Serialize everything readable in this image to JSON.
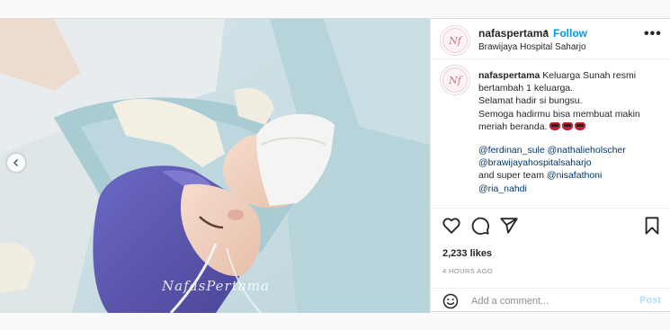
{
  "header": {
    "avatar_monogram": "Nf",
    "username": "nafaspertama",
    "separator": "•",
    "follow_label": "Follow",
    "location": "Brawijaya Hospital Saharjo",
    "more_icon": "more-horizontal-icon"
  },
  "media": {
    "watermark": "NafasPertama",
    "prev_icon": "chevron-left-icon"
  },
  "caption": {
    "username": "nafaspertama",
    "lines": [
      "Keluarga Sunah resmi",
      "bertambah 1 keluarga.",
      "Selamat hadir si bungsu.",
      "Semoga hadirmu bisa membuat makin",
      "meriah beranda."
    ],
    "emoji_count": 3,
    "mentions_line1": "@ferdinan_sule @nathalieholscher",
    "mentions_line2": "@brawijayahospitalsaharjo",
    "team_prefix": "and super team ",
    "team_mention": "@nisafathoni",
    "last_mention": "@ria_nahdi"
  },
  "actions": {
    "like_icon": "heart-icon",
    "comment_icon": "comment-icon",
    "share_icon": "send-icon",
    "save_icon": "bookmark-icon"
  },
  "likes": "2,233 likes",
  "time": "4 HOURS AGO",
  "comment": {
    "emoji_icon": "smile-icon",
    "placeholder": "Add a comment...",
    "post_label": "Post"
  },
  "colors": {
    "accent": "#0095f6",
    "mention": "#00376b",
    "post_disabled": "#b2dffc",
    "muted": "#8e8e8e"
  }
}
